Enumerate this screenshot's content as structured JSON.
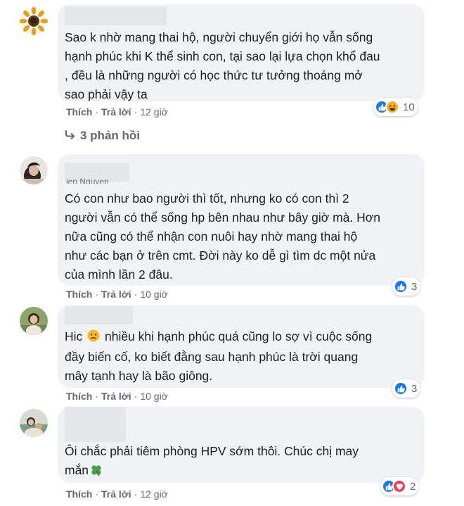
{
  "comments": [
    {
      "text": "Sao k nhờ mang thai hộ, người chuyển giới họ vẫn sống\nhạnh phúc khi K thể sinh con, tại sao lại lựa chọn khổ đau\n, đều là những người có học thức tư tưởng thoáng mở\nsao phải vậy ta",
      "like": "Thích",
      "reply": "Trả lời",
      "time": "12 giờ",
      "reaction_count": "10",
      "reactions": [
        "like",
        "haha"
      ],
      "replies_label": "3 phản hồi"
    },
    {
      "name_partial": "ien Nguyen",
      "text": "Có con như bao người thì tốt, nhưng ko có con thì 2\nngười vẫn có thể sống hp bên nhau như bây giờ mà. Hơn\nnữa cũng có thể nhận con nuôi hay nhờ mang thai hộ\nnhư các bạn ở trên cmt. Đời này ko dễ gì tìm dc một nửa\ncủa mình lần 2 đâu.",
      "like": "Thích",
      "reply": "Trả lời",
      "time": "10 giờ",
      "reaction_count": "3",
      "reactions": [
        "like"
      ]
    },
    {
      "text_before": "Hic ",
      "text_after": " nhiều khi hạnh phúc quá cũng lo sợ vì cuộc sống\nđầy biến cố, ko biết đằng sau hạnh phúc là trời quang\nmây tạnh hay là bão giông.",
      "like": "Thích",
      "reply": "Trả lời",
      "time": "10 giờ",
      "reaction_count": "3",
      "reactions": [
        "like"
      ],
      "emoji": "frowning-face-icon"
    },
    {
      "text": "Ôi chắc phải tiêm phòng HPV sớm thôi. Chúc chị may\nmắn",
      "like": "Thích",
      "reply": "Trả lời",
      "time": "12 giờ",
      "reaction_count": "2",
      "reactions": [
        "like",
        "love"
      ],
      "emoji": "four-leaf-clover-icon"
    }
  ],
  "colors": {
    "bubble": "#f0f2f5",
    "meta": "#65676b",
    "like": "#1877f2",
    "haha": "#f7b125",
    "love": "#f33e58"
  }
}
